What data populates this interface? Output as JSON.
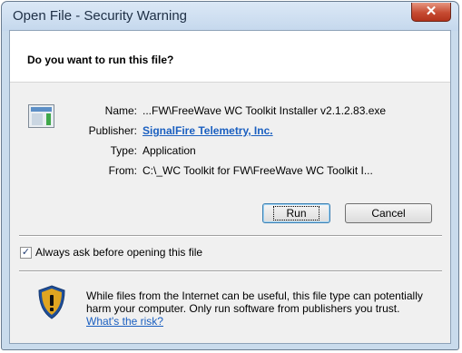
{
  "window": {
    "title": "Open File - Security Warning",
    "close_label": "✕"
  },
  "header": {
    "question": "Do you want to run this file?"
  },
  "details": {
    "name_label": "Name:",
    "name_value": "...FW\\FreeWave WC Toolkit Installer v2.1.2.83.exe",
    "publisher_label": "Publisher:",
    "publisher_value": "SignalFire Telemetry, Inc.",
    "type_label": "Type:",
    "type_value": "Application",
    "from_label": "From:",
    "from_value": "C:\\_WC Toolkit for FW\\FreeWave WC Toolkit I..."
  },
  "buttons": {
    "run": "Run",
    "cancel": "Cancel"
  },
  "checkbox": {
    "label": "Always ask before opening this file",
    "checked": true,
    "mark": "✓"
  },
  "warning": {
    "text": "While files from the Internet can be useful, this file type can potentially harm your computer. Only run software from publishers you trust. ",
    "link": "What's the risk?"
  },
  "colors": {
    "link": "#1a5fc0",
    "close": "#c64b32",
    "shield_gold": "#e0a521"
  },
  "icons": [
    "close-icon",
    "application-icon",
    "checkbox-check-icon",
    "security-shield-icon"
  ]
}
